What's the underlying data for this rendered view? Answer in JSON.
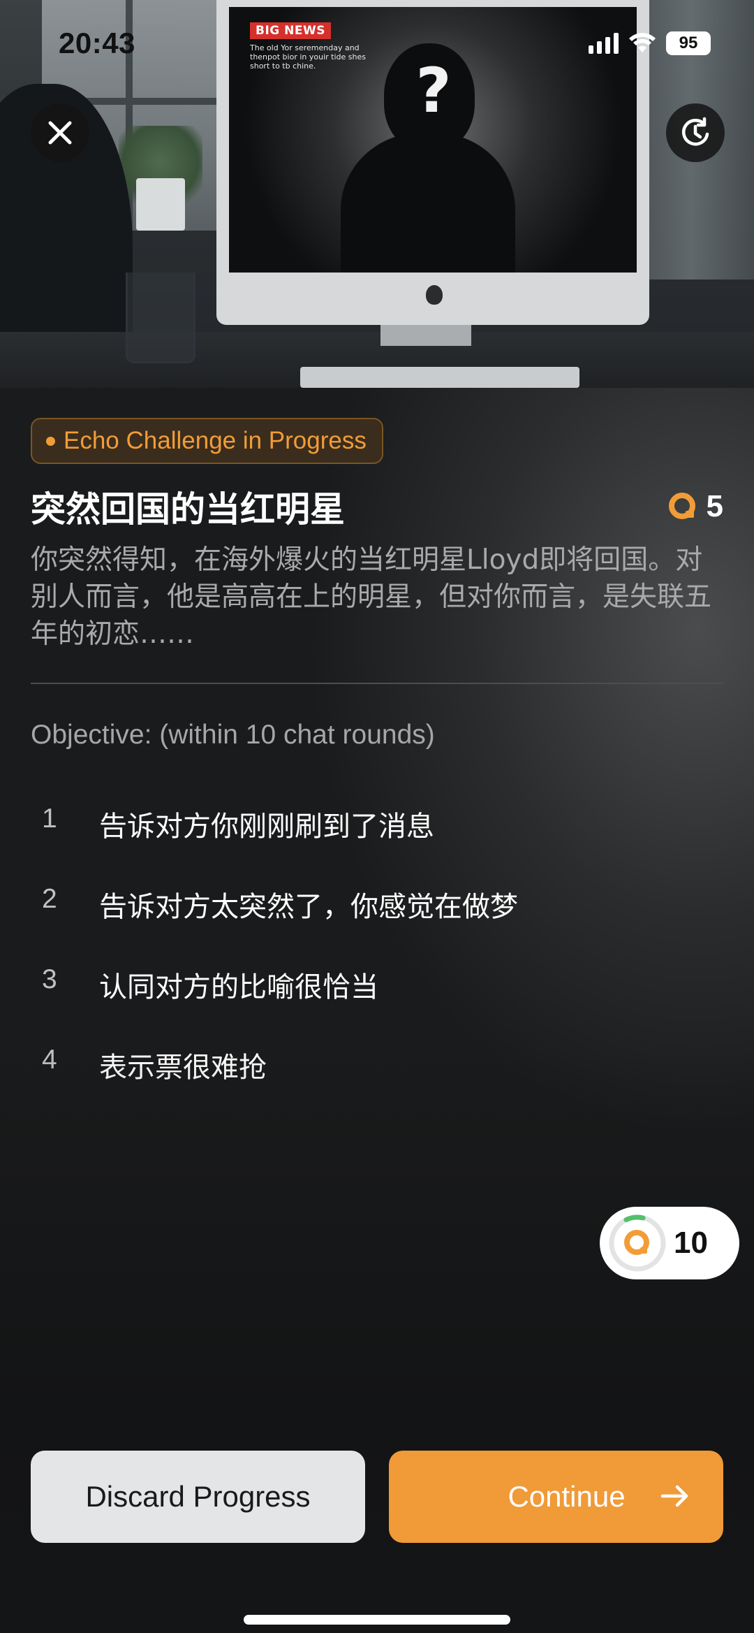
{
  "status_bar": {
    "time": "20:43",
    "battery": "95"
  },
  "hero": {
    "news_badge": "BIG NEWS",
    "news_text": "The old Yor seremenday and thenpot bior in youir tide shes short to tb chine.",
    "question_mark": "?"
  },
  "header": {
    "close_icon": "close-icon",
    "history_icon": "history-icon"
  },
  "challenge": {
    "badge": "Echo Challenge in Progress",
    "badge_color": "#f29c38",
    "title": "突然回国的当红明星",
    "coins": "5",
    "description": "你突然得知，在海外爆火的当红明星Lloyd即将回国。对别人而言，他是高高在上的明星，但对你而言，是失联五年的初恋……",
    "objective": "Objective: (within 10 chat rounds)",
    "steps": [
      {
        "num": "1",
        "text": "告诉对方你刚刚刷到了消息"
      },
      {
        "num": "2",
        "text": "告诉对方太突然了，你感觉在做梦"
      },
      {
        "num": "3",
        "text": "认同对方的比喻很恰当"
      },
      {
        "num": "4",
        "text": "表示票很难抢"
      }
    ]
  },
  "timer": {
    "count": "10"
  },
  "actions": {
    "discard": "Discard Progress",
    "continue": "Continue",
    "accent": "#f09a38"
  }
}
